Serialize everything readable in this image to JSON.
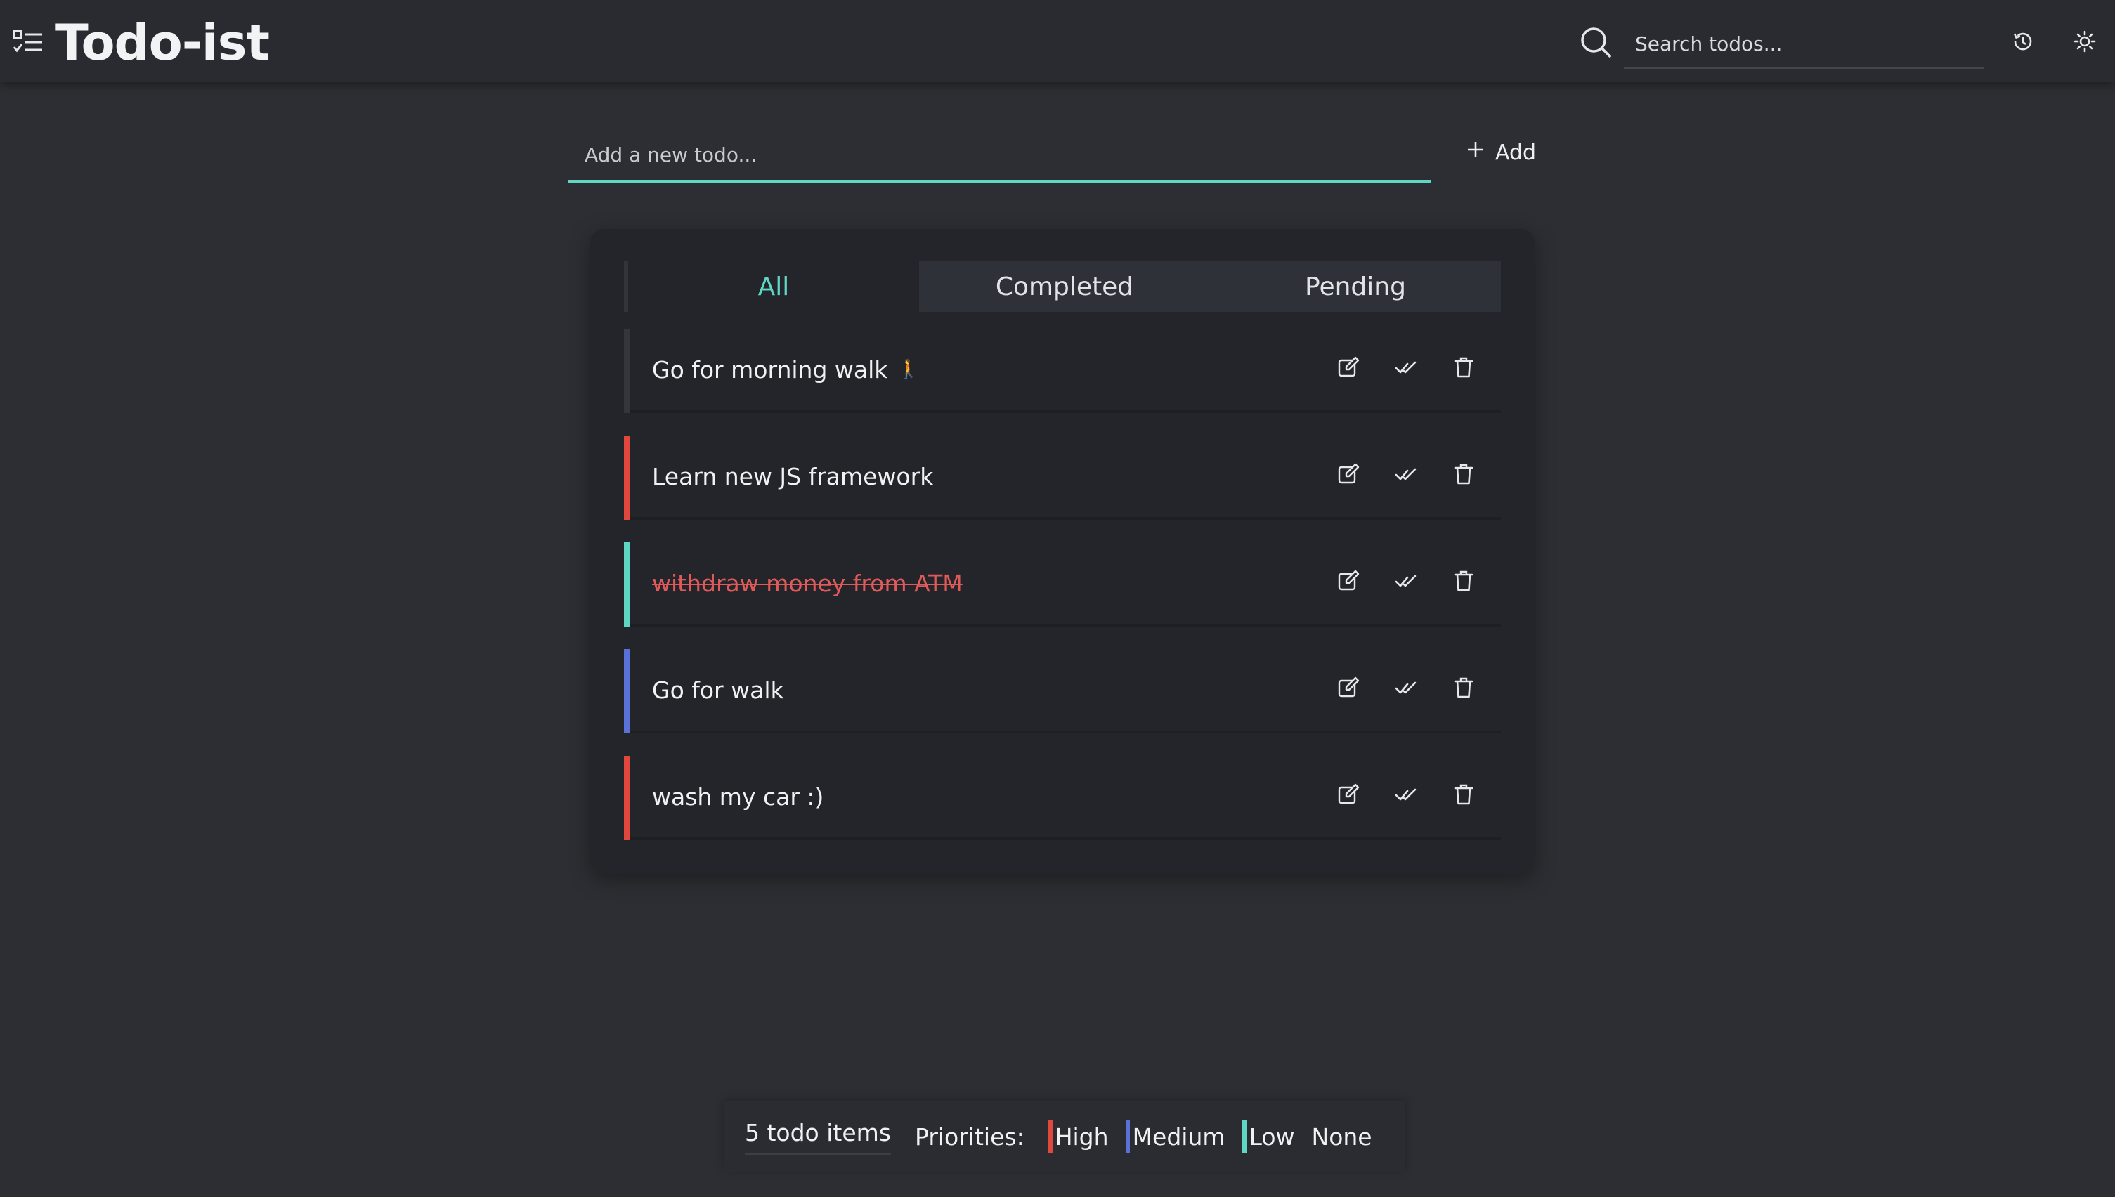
{
  "app": {
    "title": "Todo-ist"
  },
  "header": {
    "search_placeholder": "Search todos...",
    "icons": [
      "todo-list-icon",
      "search-icon",
      "history-icon",
      "theme-toggle-icon"
    ]
  },
  "add_form": {
    "placeholder": "Add a new todo...",
    "button_label": "Add"
  },
  "tabs": [
    {
      "label": "All",
      "active": true
    },
    {
      "label": "Completed",
      "active": false
    },
    {
      "label": "Pending",
      "active": false
    }
  ],
  "todos": [
    {
      "text": "Go for morning walk",
      "emoji": "🚶",
      "priority": "None",
      "completed": false
    },
    {
      "text": "Learn new JS framework",
      "priority": "High",
      "completed": false
    },
    {
      "text": "withdraw money from ATM",
      "priority": "Low",
      "completed": true
    },
    {
      "text": "Go for walk",
      "priority": "Medium",
      "completed": false
    },
    {
      "text": "wash my car :)",
      "priority": "High",
      "completed": false
    }
  ],
  "footer": {
    "count_label": "5 todo items",
    "priorities_label": "Priorities:",
    "priorities": [
      {
        "label": "High",
        "color": "#e0483e"
      },
      {
        "label": "Medium",
        "color": "#5a72d8"
      },
      {
        "label": "Low",
        "color": "#5fd5c3"
      },
      {
        "label": "None",
        "color": ""
      }
    ]
  },
  "colors": {
    "accent": "#5fd5c3",
    "high": "#e0483e",
    "medium": "#5a72d8",
    "low": "#5fd5c3",
    "none": "#34363c",
    "completed_text": "#e05a5a"
  }
}
